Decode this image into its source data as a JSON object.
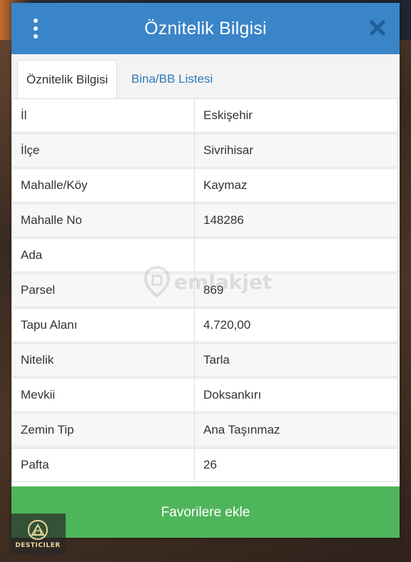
{
  "header": {
    "title": "Öznitelik Bilgisi",
    "menu_icon": "kebab-vertical-icon",
    "close_icon": "close-icon"
  },
  "tabs": [
    {
      "label": "Öznitelik Bilgisi",
      "active": true
    },
    {
      "label": "Bina/BB Listesi",
      "active": false
    }
  ],
  "attributes": [
    {
      "key": "İl",
      "value": "Eskişehir"
    },
    {
      "key": "İlçe",
      "value": "Sivrihisar"
    },
    {
      "key": "Mahalle/Köy",
      "value": "Kaymaz"
    },
    {
      "key": "Mahalle No",
      "value": "148286"
    },
    {
      "key": "Ada",
      "value": ""
    },
    {
      "key": "Parsel",
      "value": "869"
    },
    {
      "key": "Tapu Alanı",
      "value": "4.720,00"
    },
    {
      "key": "Nitelik",
      "value": "Tarla"
    },
    {
      "key": "Mevkii",
      "value": "Doksankırı"
    },
    {
      "key": "Zemin Tip",
      "value": "Ana Taşınmaz"
    },
    {
      "key": "Pafta",
      "value": "26"
    }
  ],
  "watermark": {
    "text": "emlakjet",
    "icon": "location-pin-icon"
  },
  "footer": {
    "favorite_label": "Favorilere ekle"
  },
  "corner_logo": {
    "name": "DESTICILER"
  },
  "colors": {
    "header_bg": "#3a84c8",
    "tab_link": "#2f7ab8",
    "button_bg": "#4fb55a"
  }
}
